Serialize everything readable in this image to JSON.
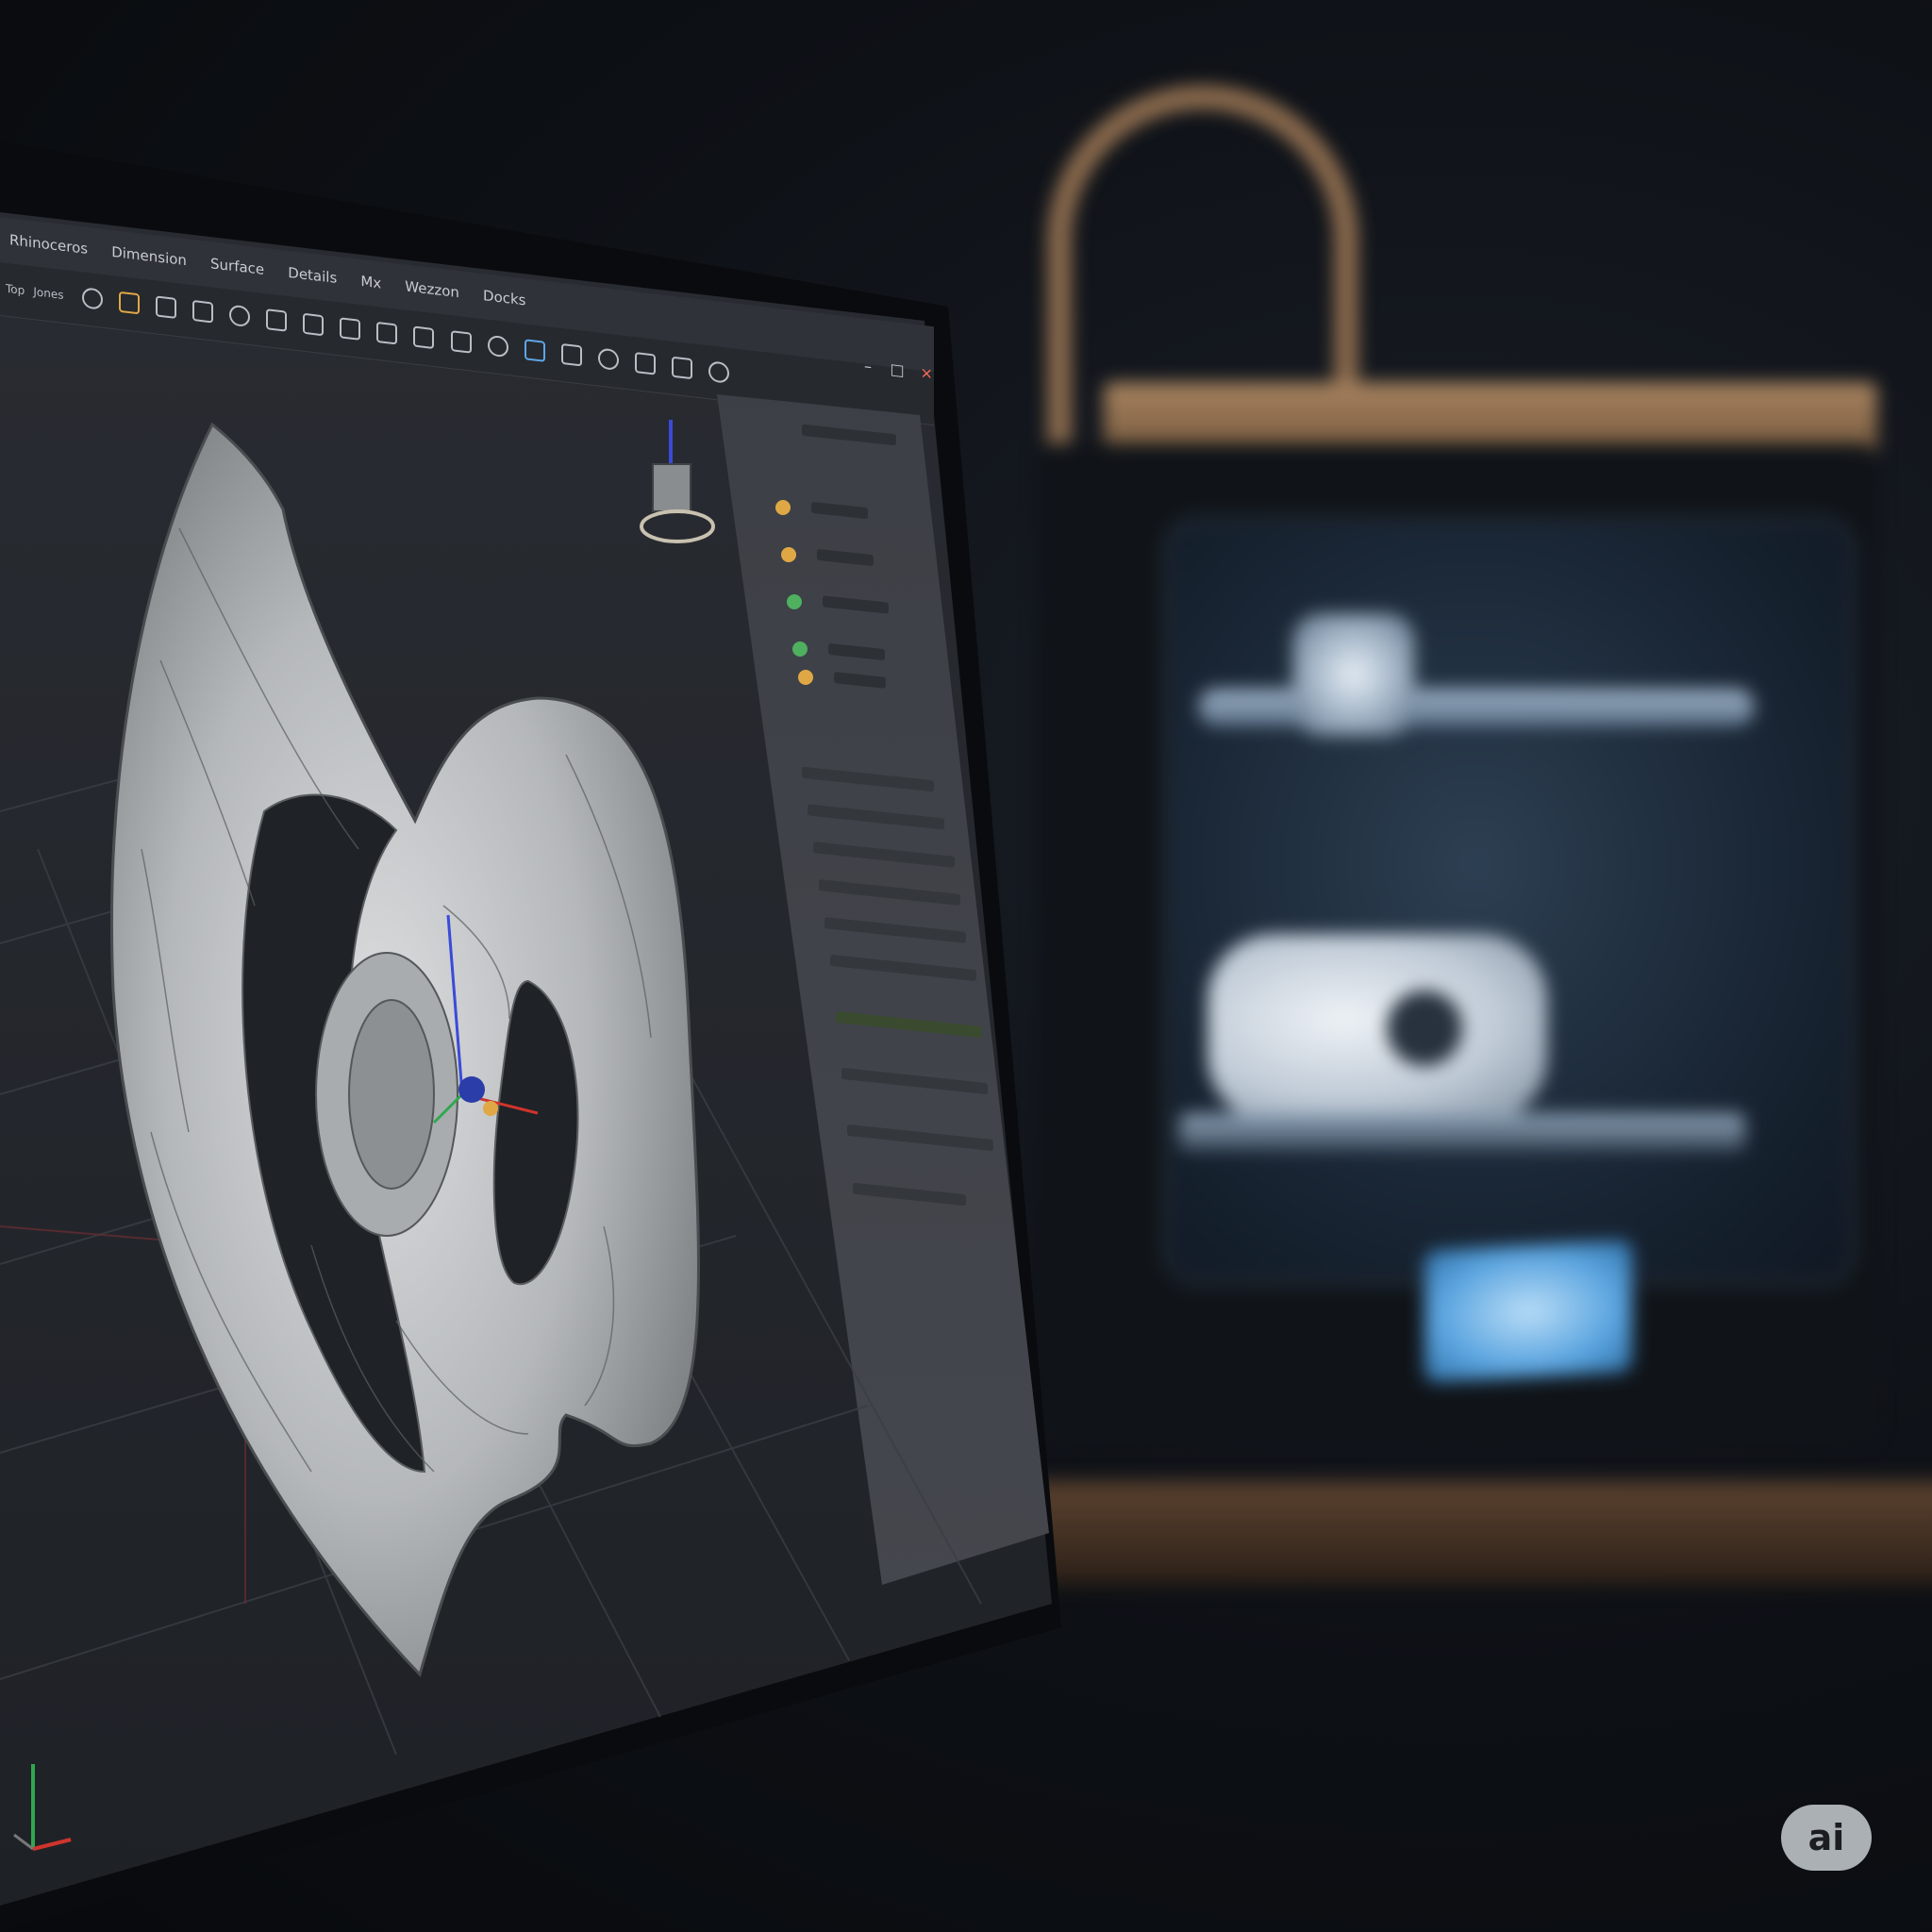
{
  "app": {
    "menu": [
      "Rhinoceros",
      "Dimension",
      "Surface",
      "Details",
      "Mx",
      "Wezzon",
      "Docks"
    ],
    "toolbar_labels": [
      "Top",
      "Jones"
    ],
    "window_buttons": [
      "–",
      "□",
      "×"
    ]
  },
  "model": {
    "name": "organic-shell-part",
    "color": "#c9cbcd"
  },
  "printer": {
    "screen_color": "#5aa4df",
    "frame_color": "#8a6a4d"
  },
  "watermark": {
    "label": "ai"
  },
  "colors": {
    "axis_x": "#d0342c",
    "axis_y": "#2fa84f",
    "axis_z": "#3a4ad8",
    "panel_accent": "#e0a845"
  }
}
